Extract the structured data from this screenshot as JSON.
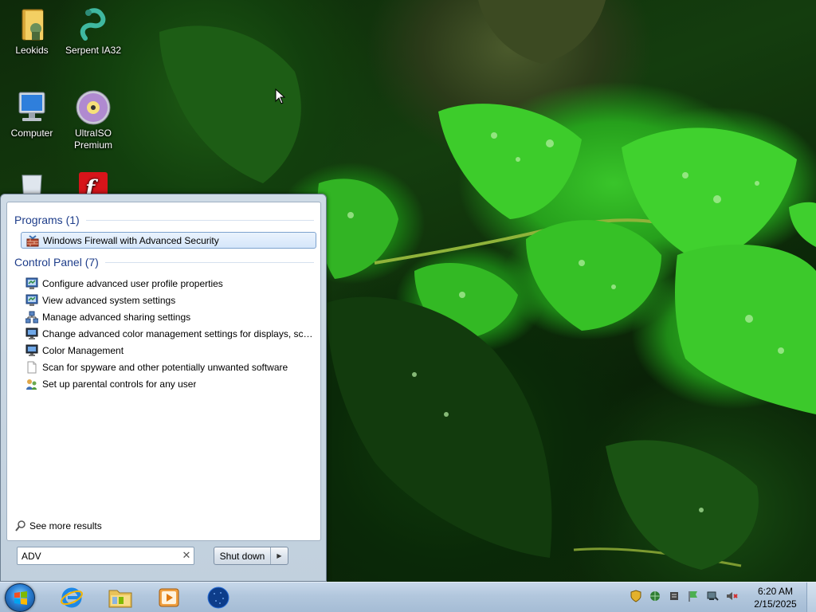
{
  "desktop": {
    "icons": [
      {
        "label": "Leokids"
      },
      {
        "label": "Serpent IA32"
      },
      {
        "label": "Computer"
      },
      {
        "label": "UltraISO\nPremium"
      },
      {
        "label": ""
      },
      {
        "label": ""
      }
    ]
  },
  "start_menu": {
    "groups": {
      "programs": {
        "header": "Programs (1)",
        "items": [
          {
            "label": "Windows Firewall with Advanced Security",
            "icon": "firewall-icon"
          }
        ]
      },
      "control_panel": {
        "header": "Control Panel (7)",
        "items": [
          {
            "label": "Configure advanced user profile properties",
            "icon": "control-panel-icon"
          },
          {
            "label": "View advanced system settings",
            "icon": "control-panel-icon"
          },
          {
            "label": "Manage advanced sharing settings",
            "icon": "network-icon"
          },
          {
            "label": "Change advanced color management settings for displays, sca...",
            "icon": "monitor-icon"
          },
          {
            "label": "Color Management",
            "icon": "monitor-icon"
          },
          {
            "label": "Scan for spyware and other potentially unwanted software",
            "icon": "blank-page-icon"
          },
          {
            "label": "Set up parental controls for any user",
            "icon": "parental-controls-icon"
          }
        ]
      }
    },
    "see_more": "See more results",
    "search": {
      "value": "ADV"
    },
    "shutdown_label": "Shut down"
  },
  "taskbar": {
    "clock": {
      "time": "6:20 AM",
      "date": "2/15/2025"
    }
  },
  "colors": {
    "group_header": "#1e3d8a",
    "selection_border": "#7da2ce",
    "taskbar": "#b2c7dd"
  }
}
